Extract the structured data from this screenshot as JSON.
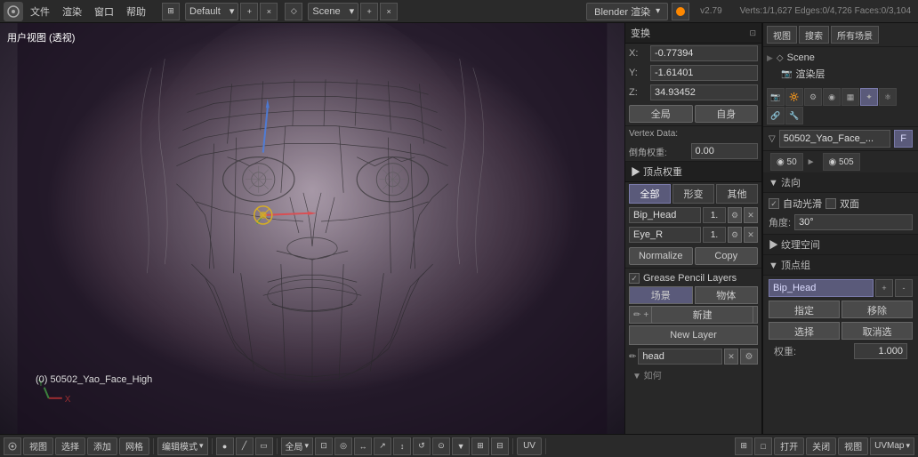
{
  "topbar": {
    "blender_icon": "B",
    "menu_items": [
      "文件",
      "渲染",
      "窗口",
      "帮助"
    ],
    "layout": "Default",
    "scene": "Scene",
    "render_engine": "Blender 渲染",
    "version": "v2.79",
    "stats": "Verts:1/1,627  Edges:0/4,726  Faces:0/3,104"
  },
  "viewport": {
    "label": "用户视图 (透视)",
    "obj_name": "(0) 50502_Yao_Face_High"
  },
  "transform_panel": {
    "title": "变换",
    "coords": {
      "x_label": "X:",
      "x_value": "-0.77394",
      "y_label": "Y:",
      "y_value": "-1.61401",
      "z_label": "Z:",
      "z_value": "34.93452"
    },
    "global_btn": "全局",
    "local_btn": "自身",
    "vertex_data": "Vertex Data:",
    "bevel_label": "倒角权重:",
    "bevel_value": "0.00",
    "vertex_weight_title": "▶ 顶点权重",
    "tabs": {
      "all": "全部",
      "shape": "形变",
      "other": "其他"
    },
    "groups": [
      {
        "name": "Bip_Head",
        "weight": "1.",
        "btn1": "⚙",
        "btn2": "✕"
      },
      {
        "name": "Eye_R",
        "weight": "1.",
        "btn1": "⚙",
        "btn2": "✕"
      }
    ],
    "normalize_btn": "Normalize",
    "copy_btn": "Copy",
    "grease_title": "Grease Pencil Layers",
    "grease_checkbox": true,
    "scene_btn": "场景",
    "body_btn": "物体",
    "new_btn": "新建",
    "new_layer_btn": "New Layer",
    "head_input": "head",
    "small_label": "▼ 如何"
  },
  "properties_panel": {
    "scene_tree": {
      "title": "Scene",
      "items": [
        {
          "name": "渲染层",
          "icon": "📷",
          "expanded": false
        }
      ]
    },
    "object_name": "50502_Yao_Face_...",
    "f_btn": "F",
    "sections": {
      "normals": {
        "title": "▼ 法向",
        "smooth_label": "自动光滑",
        "double_label": "双面",
        "angle_label": "角度:",
        "angle_value": "30°"
      },
      "texture_space": {
        "title": "▶ 纹理空间"
      },
      "vertex_groups": {
        "title": "▼ 顶点组",
        "group_name": "Bip_Head",
        "action_btns": [
          "指定",
          "移除",
          "选择",
          "取消选"
        ]
      }
    },
    "weight_label": "权重:",
    "weight_value": "1.000"
  },
  "bottom_toolbar": {
    "mode_btn": "编辑模式",
    "view_btn": "视图",
    "select_btn": "选择",
    "add_btn": "添加",
    "mesh_btn": "网格",
    "global_btn": "全局",
    "uv_btn": "UV",
    "open_btn": "打开",
    "close_btn": "关闭",
    "view2_btn": "视图",
    "uvmap_btn": "UVMap"
  }
}
